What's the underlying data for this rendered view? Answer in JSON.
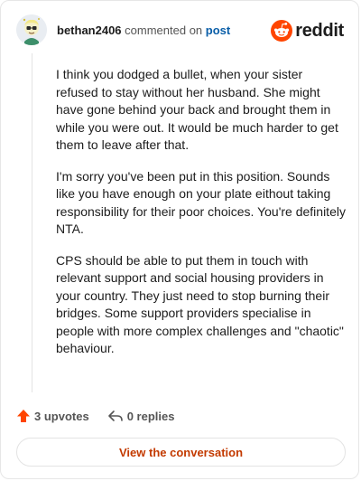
{
  "header": {
    "username": "bethan2406",
    "action_text": "commented on",
    "post_link": "post",
    "brand": "reddit"
  },
  "comment": {
    "paragraphs": [
      "I think you dodged a bullet, when your sister refused to stay without her husband. She might have gone behind your back and brought them in while you were out. It would be much harder to get them to leave after that.",
      "I'm sorry you've been put in this position. Sounds like you have enough on your plate eithout taking responsibility for their poor choices. You're definitely NTA.",
      "CPS should be able to put them in touch with relevant support and social housing providers in your country. They just need to stop burning their bridges. Some support providers specialise in people with more complex challenges and \"chaotic\" behaviour."
    ]
  },
  "actions": {
    "upvotes": "3 upvotes",
    "replies": "0 replies"
  },
  "cta": {
    "label": "View the conversation"
  },
  "colors": {
    "brand": "#ff4500",
    "upvote": "#ff4500",
    "link": "#0a5ea8",
    "cta_text": "#c33a00"
  }
}
